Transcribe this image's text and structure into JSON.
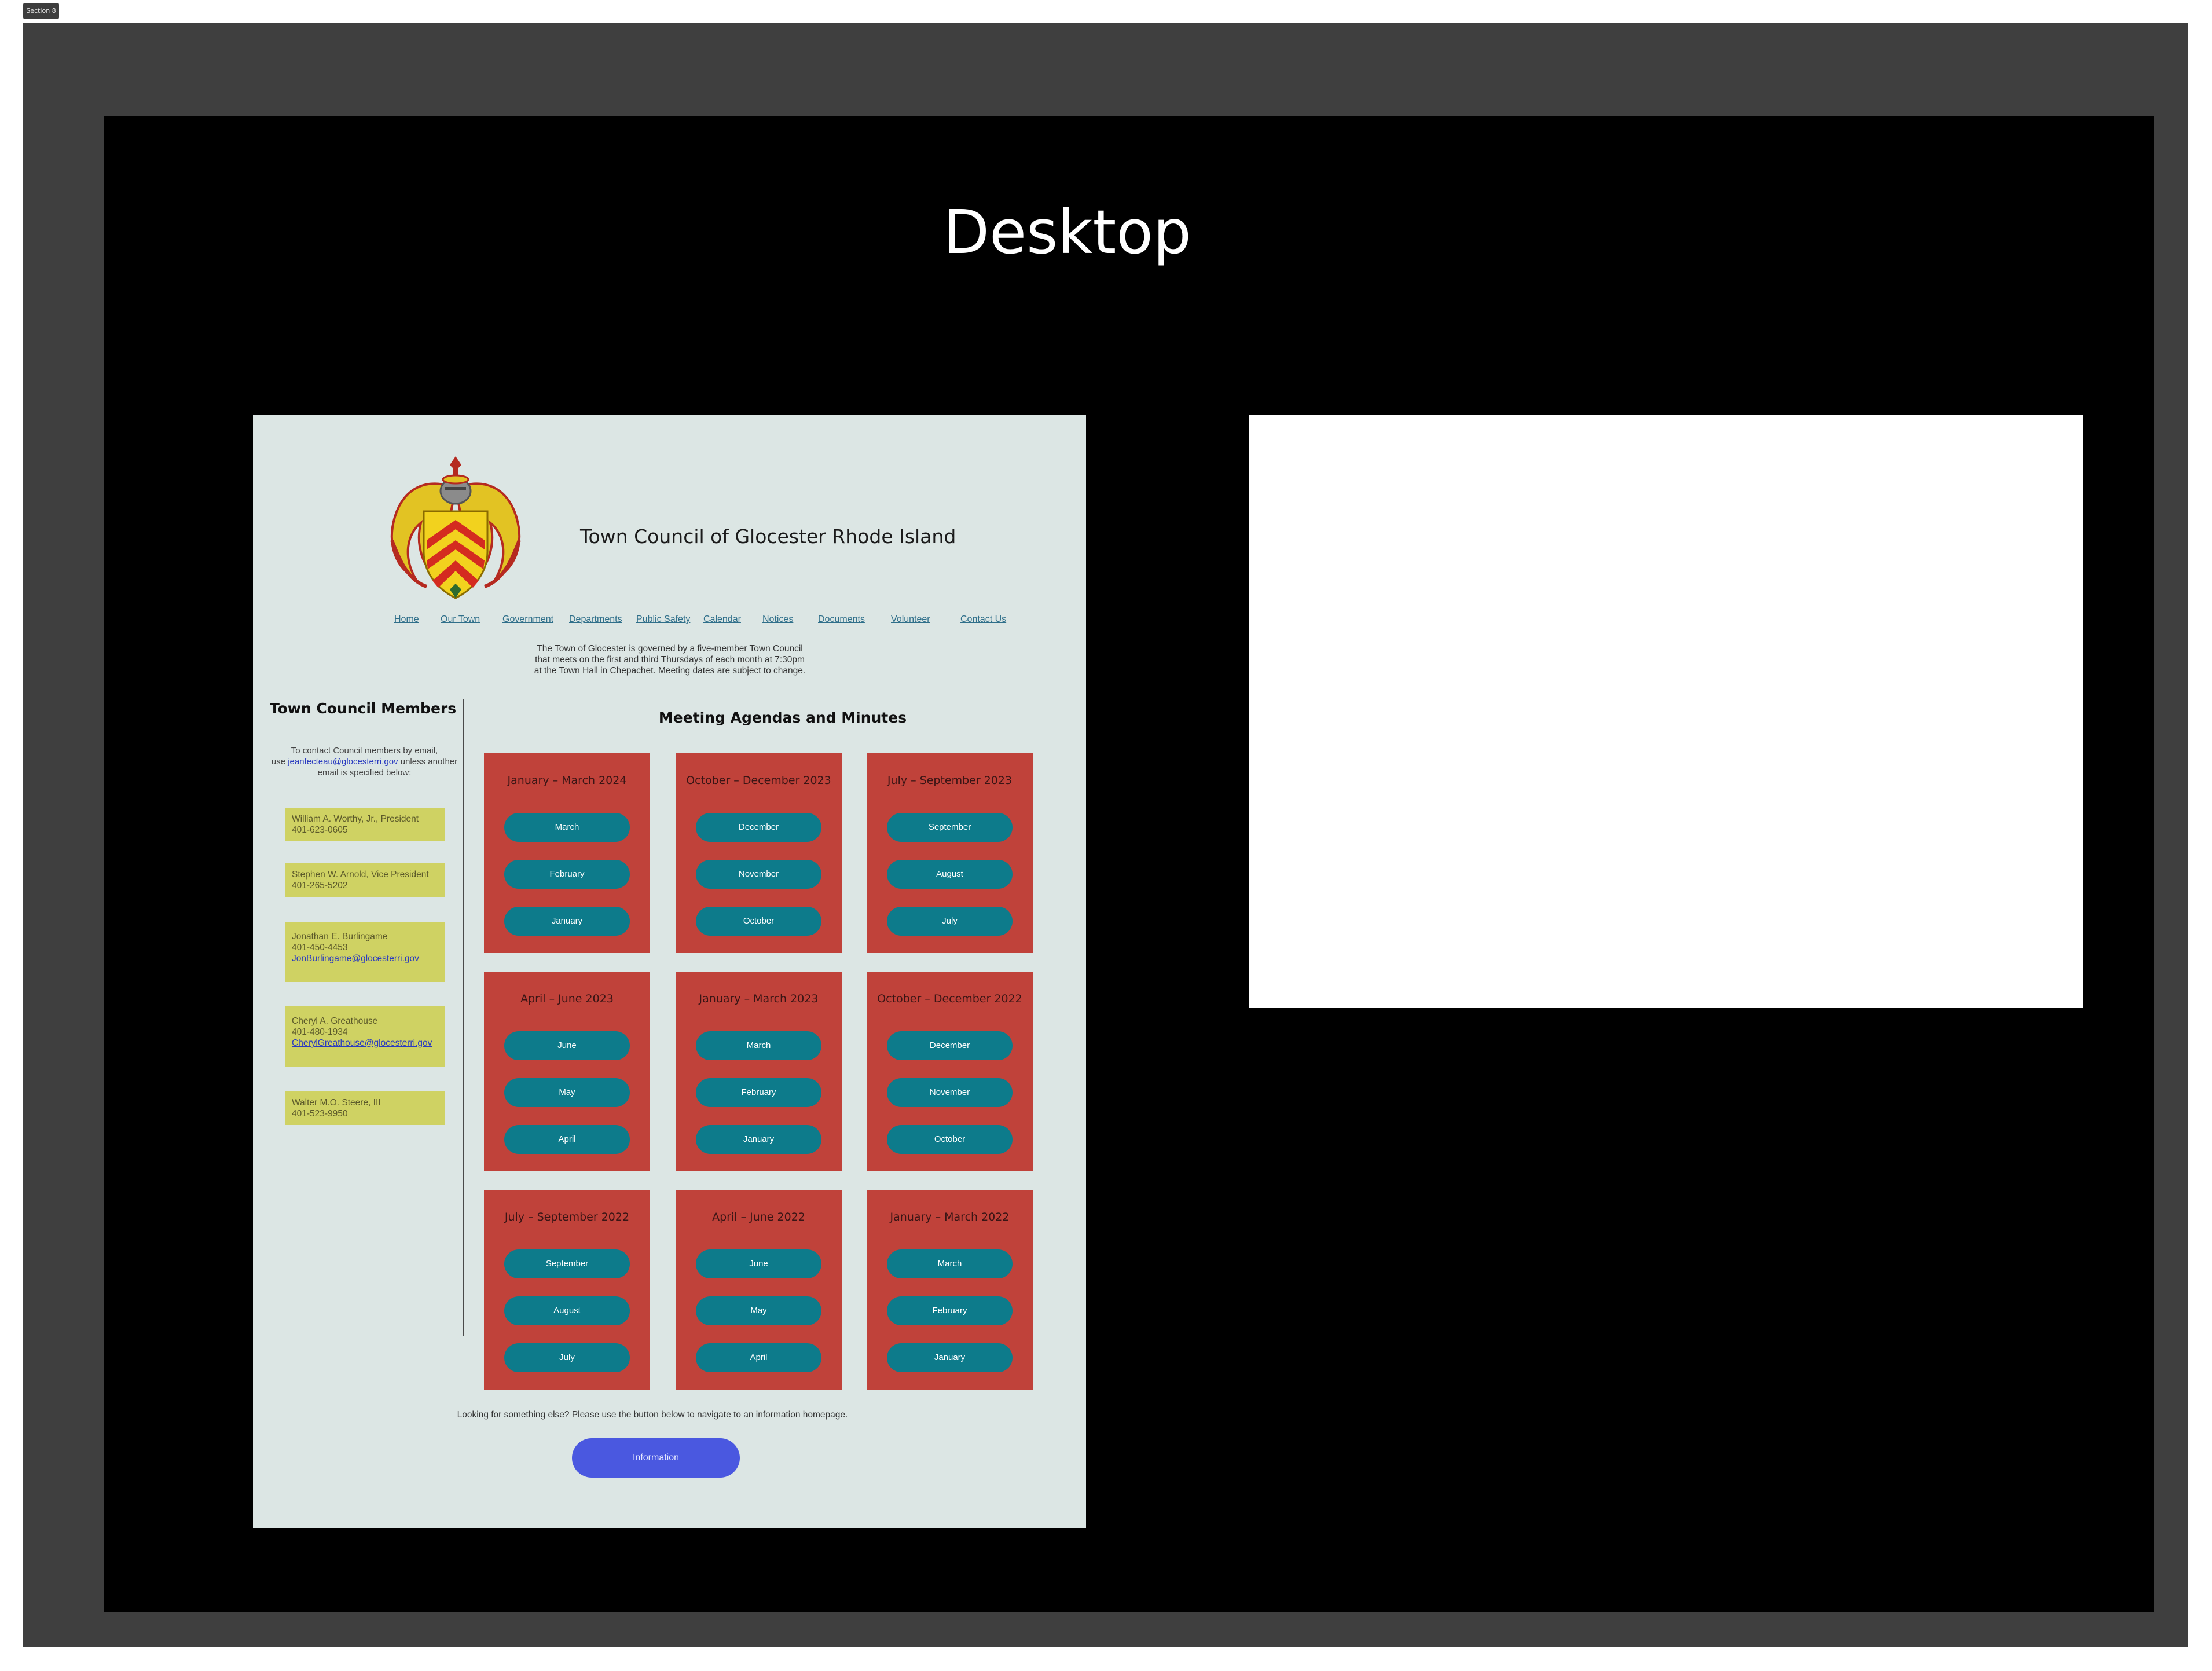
{
  "canvas": {
    "section_label": "Section 8",
    "frame_title": "Desktop"
  },
  "site": {
    "title": "Town Council of Glocester Rhode Island",
    "nav": [
      "Home",
      "Our Town",
      "Government",
      "Departments",
      "Public Safety",
      "Calendar",
      "Notices",
      "Documents",
      "Volunteer",
      "Contact Us"
    ],
    "intro": [
      "The Town of Glocester is governed by a five-member Town Council",
      "that meets on the first and third Thursdays of each month at 7:30pm",
      "at the Town Hall in Chepachet. Meeting dates are subject to change."
    ]
  },
  "members": {
    "title": "Town Council Members",
    "contact_prefix": "To contact Council members by email,",
    "contact_use": "use",
    "contact_email": "jeanfecteau@glocesterri.gov",
    "contact_suffix": "unless another",
    "contact_tail": "email is specified below:",
    "list": [
      {
        "name": "William A. Worthy, Jr., President",
        "phone": "401-623-0605",
        "email": ""
      },
      {
        "name": "Stephen W. Arnold, Vice President",
        "phone": "401-265-5202",
        "email": ""
      },
      {
        "name": "Jonathan E. Burlingame",
        "phone": "401-450-4453",
        "email": "JonBurlingame@glocesterri.gov"
      },
      {
        "name": "Cheryl A. Greathouse",
        "phone": "401-480-1934",
        "email": "CherylGreathouse@glocesterri.gov"
      },
      {
        "name": "Walter M.O. Steere, III",
        "phone": "401-523-9950",
        "email": ""
      }
    ]
  },
  "meetings": {
    "title": "Meeting Agendas and Minutes",
    "quarters": [
      {
        "title": "January – March 2024",
        "months": [
          "March",
          "February",
          "January"
        ]
      },
      {
        "title": "October – December 2023",
        "months": [
          "December",
          "November",
          "October"
        ]
      },
      {
        "title": "July – September 2023",
        "months": [
          "September",
          "August",
          "July"
        ]
      },
      {
        "title": "April – June 2023",
        "months": [
          "June",
          "May",
          "April"
        ]
      },
      {
        "title": "January – March 2023",
        "months": [
          "March",
          "February",
          "January"
        ]
      },
      {
        "title": "October – December 2022",
        "months": [
          "December",
          "November",
          "October"
        ]
      },
      {
        "title": "July – September 2022",
        "months": [
          "September",
          "August",
          "July"
        ]
      },
      {
        "title": "April – June 2022",
        "months": [
          "June",
          "May",
          "April"
        ]
      },
      {
        "title": "January – March 2022",
        "months": [
          "March",
          "February",
          "January"
        ]
      }
    ]
  },
  "footer": {
    "note": "Looking for something else? Please use the button below to navigate to an information homepage.",
    "button": "Information"
  },
  "colors": {
    "page_bg": "#dce6e4",
    "card_bg": "#c0423a",
    "pill_bg": "#0d7b8b",
    "member_bg": "#cfd263",
    "button_bg": "#4a58e0"
  }
}
